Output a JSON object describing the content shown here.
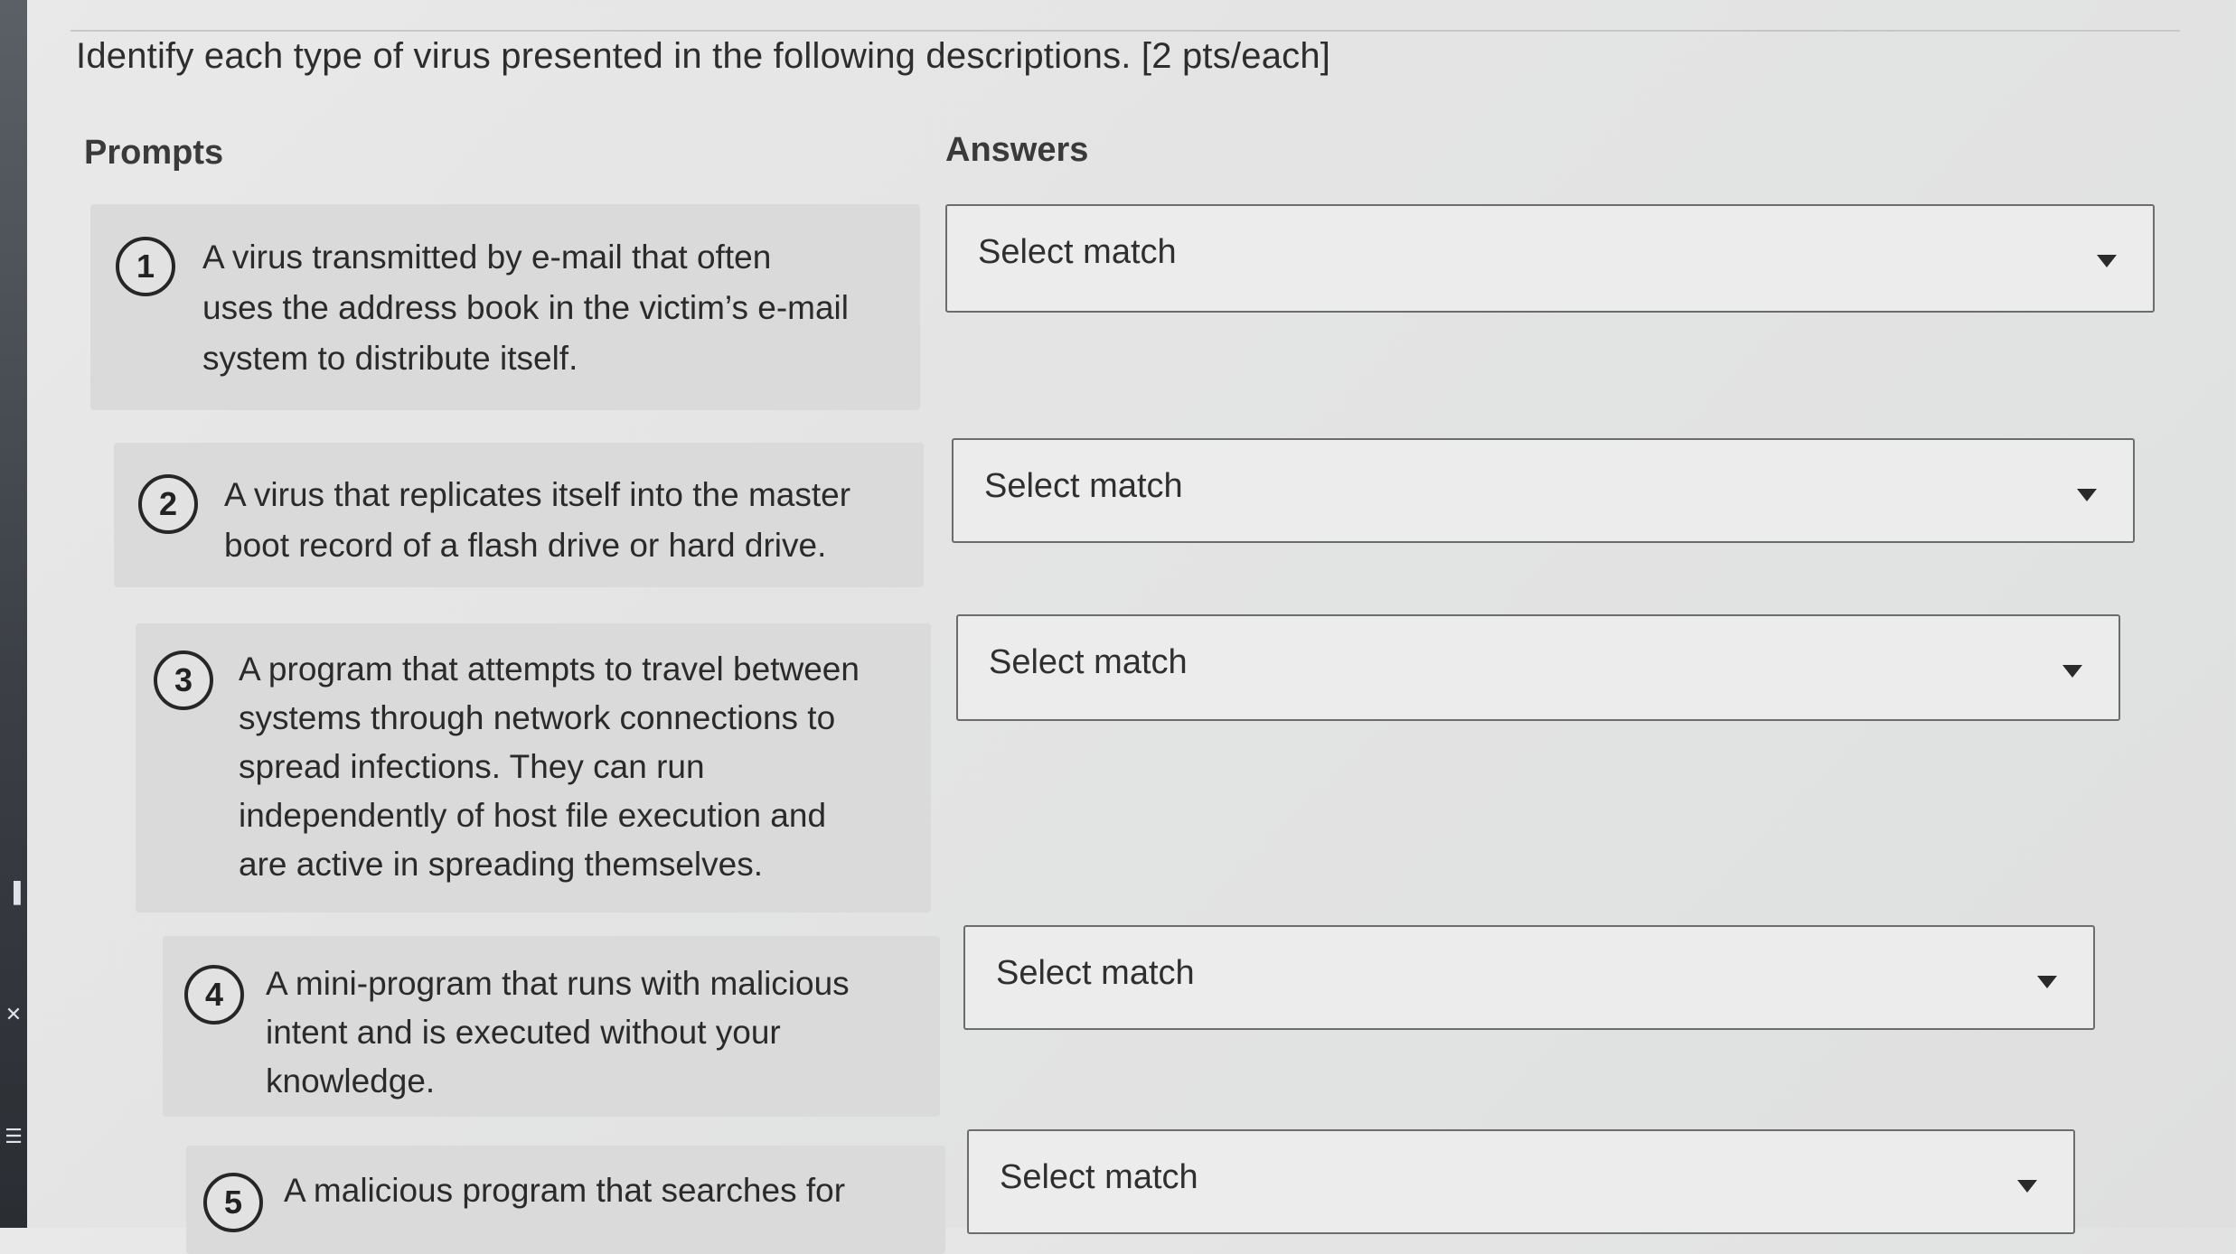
{
  "instruction": "Identify each type of virus presented in the following descriptions. [2 pts/each]",
  "headers": {
    "prompts": "Prompts",
    "answers": "Answers"
  },
  "items": [
    {
      "number": "1",
      "text": "A virus transmitted by e-mail that often\nuses the address book in the victim’s e-mail\nsystem to distribute itself.",
      "answer": "Select match"
    },
    {
      "number": "2",
      "text": "A virus that replicates itself into the master\nboot record of a flash drive or hard drive.",
      "answer": "Select match"
    },
    {
      "number": "3",
      "text": "A program that attempts to travel between\nsystems through network connections to\nspread infections. They can run\nindependently of host file execution and\nare active in spreading themselves.",
      "answer": "Select match"
    },
    {
      "number": "4",
      "text": "A mini-program that runs with malicious\nintent and is executed without your\nknowledge.",
      "answer": "Select match"
    },
    {
      "number": "5",
      "text": "A malicious program that searches for",
      "answer": "Select match"
    }
  ]
}
